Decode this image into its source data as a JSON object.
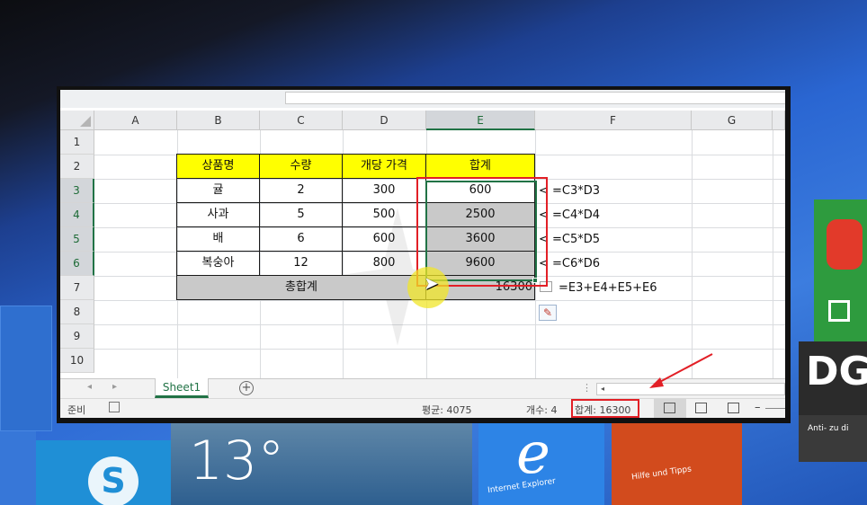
{
  "desktop": {
    "weather_temp": "13°",
    "ie_label": "Internet Explorer",
    "help_label": "Hilfe und Tipps",
    "dg_text": "DG",
    "trophy_text": "Anti-\nzu di",
    "skype_glyph": "S",
    "ie_glyph": "e"
  },
  "spreadsheet": {
    "columns": [
      "A",
      "B",
      "C",
      "D",
      "E",
      "F",
      "G"
    ],
    "rows": [
      "1",
      "2",
      "3",
      "4",
      "5",
      "6",
      "7",
      "8",
      "9",
      "10"
    ],
    "selected_column": "E",
    "selected_rows": [
      "3",
      "4",
      "5",
      "6"
    ],
    "table": {
      "headers": [
        "상품명",
        "수량",
        "개당 가격",
        "합계"
      ],
      "rows": [
        {
          "name": "귤",
          "qty": "2",
          "price": "300",
          "total": "600",
          "formula": "< =C3*D3"
        },
        {
          "name": "사과",
          "qty": "5",
          "price": "500",
          "total": "2500",
          "formula": "< =C4*D4"
        },
        {
          "name": "배",
          "qty": "6",
          "price": "600",
          "total": "3600",
          "formula": "< =C5*D5"
        },
        {
          "name": "복숭아",
          "qty": "12",
          "price": "800",
          "total": "9600",
          "formula": "< =C6*D6"
        }
      ],
      "grand_total_label": "총합계",
      "grand_total_value": "16300",
      "grand_total_formula": "=E3+E4+E5+E6"
    },
    "colors": {
      "header_fill": "#ffff00",
      "selection_fill": "#c9c9c9",
      "excel_green": "#217346",
      "annotation_red": "#e21f26"
    }
  },
  "tabbar": {
    "sheet_name": "Sheet1",
    "add_sheet_glyph": "+",
    "nav_prev": "◂",
    "nav_next": "▸",
    "dots": "⋮",
    "scroll_left": "◂"
  },
  "statusbar": {
    "ready": "준비",
    "average": "평균: 4075",
    "count": "개수: 4",
    "sum": "합계: 16300",
    "zoom_minus": "–"
  },
  "icons": {
    "quick_analysis": "quick-analysis-icon",
    "paste_options": "paste-options-icon",
    "normal_view": "normal-view-icon",
    "page_layout": "page-layout-view-icon",
    "page_break": "page-break-view-icon",
    "macro": "macro-record-icon"
  }
}
